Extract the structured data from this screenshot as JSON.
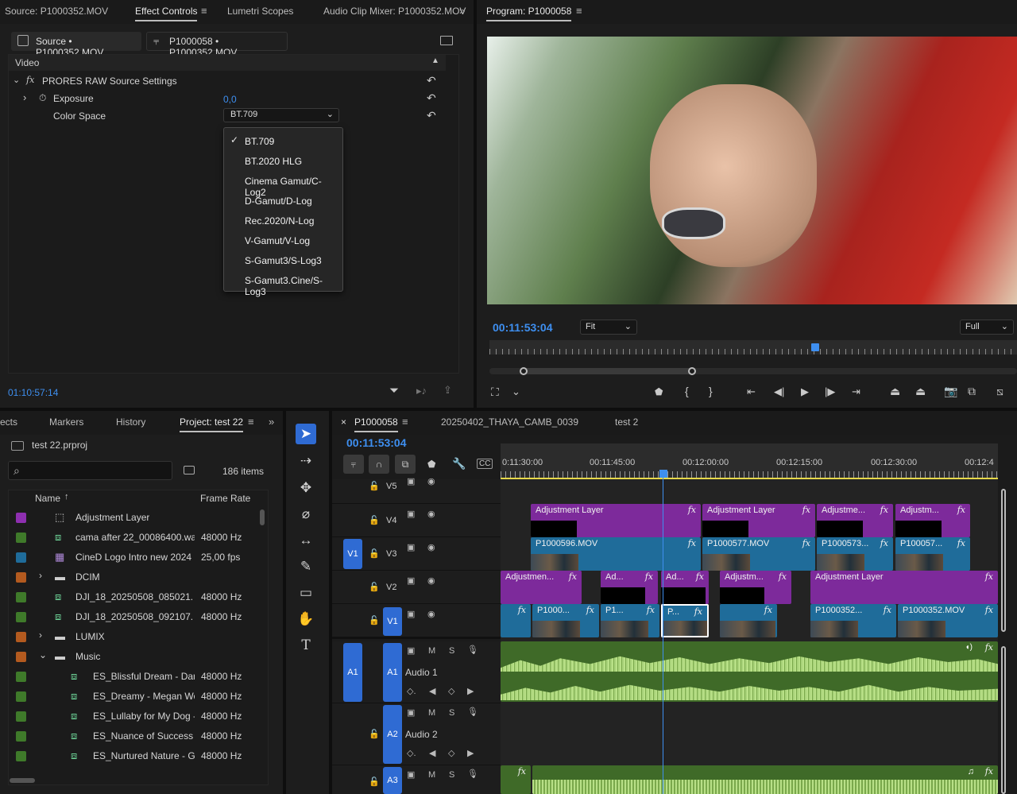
{
  "source_panel": {
    "tabs": [
      "Source: P1000352.MOV",
      "Effect Controls",
      "Lumetri Scopes",
      "Audio Clip Mixer: P1000352.MOV"
    ],
    "source_btn": "Source • P1000352.MOV",
    "sequence_btn": "P1000058 • P1000352.MOV",
    "section": "Video",
    "effect": "PRORES RAW Source Settings",
    "exposure_label": "Exposure",
    "exposure_value": "0,0",
    "colorspace_label": "Color Space",
    "colorspace_value": "BT.709",
    "menu_options": [
      "BT.709",
      "BT.2020 HLG",
      "Cinema Gamut/C-Log2",
      "D-Gamut/D-Log",
      "Rec.2020/N-Log",
      "V-Gamut/V-Log",
      "S-Gamut3/S-Log3",
      "S-Gamut3.Cine/S-Log3"
    ],
    "menu_checked": "BT.709",
    "timecode": "01:10:57:14"
  },
  "program": {
    "title": "Program: P1000058",
    "timecode": "00:11:53:04",
    "fit": "Fit",
    "quality": "Full"
  },
  "project": {
    "tabs": [
      "ects",
      "Markers",
      "History",
      "Project: test 22"
    ],
    "project_file": "test 22.prproj",
    "items_count": "186 items",
    "col_name": "Name",
    "col_rate": "Frame Rate",
    "items": [
      {
        "name": "Adjustment Layer",
        "rate": "",
        "color": "#8e2fb0",
        "type": "adjust",
        "indent": 0,
        "expand": ""
      },
      {
        "name": "cama after 22_00086400.wa",
        "rate": "48000 Hz",
        "color": "#3f7a2a",
        "type": "audio",
        "indent": 0,
        "expand": ""
      },
      {
        "name": "CineD Logo Intro new 2024",
        "rate": "25,00 fps",
        "color": "#1f6c9a",
        "type": "seq",
        "indent": 0,
        "expand": ""
      },
      {
        "name": "DCIM",
        "rate": "",
        "color": "#b35a1f",
        "type": "folder",
        "indent": 0,
        "expand": "›"
      },
      {
        "name": "DJI_18_20250508_085021.",
        "rate": "48000 Hz",
        "color": "#3f7a2a",
        "type": "audio",
        "indent": 0,
        "expand": ""
      },
      {
        "name": "DJI_18_20250508_092107.",
        "rate": "48000 Hz",
        "color": "#3f7a2a",
        "type": "audio",
        "indent": 0,
        "expand": ""
      },
      {
        "name": "LUMIX",
        "rate": "",
        "color": "#b35a1f",
        "type": "folder",
        "indent": 0,
        "expand": "›"
      },
      {
        "name": "Music",
        "rate": "",
        "color": "#b35a1f",
        "type": "folder",
        "indent": 0,
        "expand": "⌄"
      },
      {
        "name": "ES_Blissful Dream - Dan",
        "rate": "48000 Hz",
        "color": "#3f7a2a",
        "type": "audio",
        "indent": 1,
        "expand": ""
      },
      {
        "name": "ES_Dreamy - Megan Wo",
        "rate": "48000 Hz",
        "color": "#3f7a2a",
        "type": "audio",
        "indent": 1,
        "expand": ""
      },
      {
        "name": "ES_Lullaby for My Dog -",
        "rate": "48000 Hz",
        "color": "#3f7a2a",
        "type": "audio",
        "indent": 1,
        "expand": ""
      },
      {
        "name": "ES_Nuance of Success -",
        "rate": "48000 Hz",
        "color": "#3f7a2a",
        "type": "audio",
        "indent": 1,
        "expand": ""
      },
      {
        "name": "ES_Nurtured Nature - G",
        "rate": "48000 Hz",
        "color": "#3f7a2a",
        "type": "audio",
        "indent": 1,
        "expand": ""
      }
    ]
  },
  "timeline": {
    "tabs": [
      "P1000058",
      "20250402_THAYA_CAMB_0039",
      "test 2"
    ],
    "timecode": "00:11:53:04",
    "ruler": [
      "0:11:30:00",
      "00:11:45:00",
      "00:12:00:00",
      "00:12:15:00",
      "00:12:30:00",
      "00:12:4"
    ],
    "tracks": {
      "v5": "V5",
      "v4": "V4",
      "v3": "V3",
      "v2": "V2",
      "v1": "V1",
      "a1": "A1",
      "a2": "A2",
      "a3": "A3",
      "src_v": "V1",
      "src_a": "A1",
      "audio1": "Audio 1",
      "audio2": "Audio 2",
      "m": "M",
      "s": "S"
    },
    "clips": {
      "v4": [
        "Adjustment Layer",
        "Adjustment Layer",
        "Adjustme...",
        "Adjustm..."
      ],
      "v3": [
        "P1000596.MOV",
        "P1000577.MOV",
        "P1000573...",
        "P100057..."
      ],
      "v2": [
        "Adjustmen...",
        "Ad...",
        "Ad...",
        "Adjustm...",
        "Adjustment Layer"
      ],
      "v1": [
        "P1000...",
        "P1...",
        "P...",
        "P1000352...",
        "P1000352.MOV"
      ],
      "fx": "fx"
    }
  }
}
